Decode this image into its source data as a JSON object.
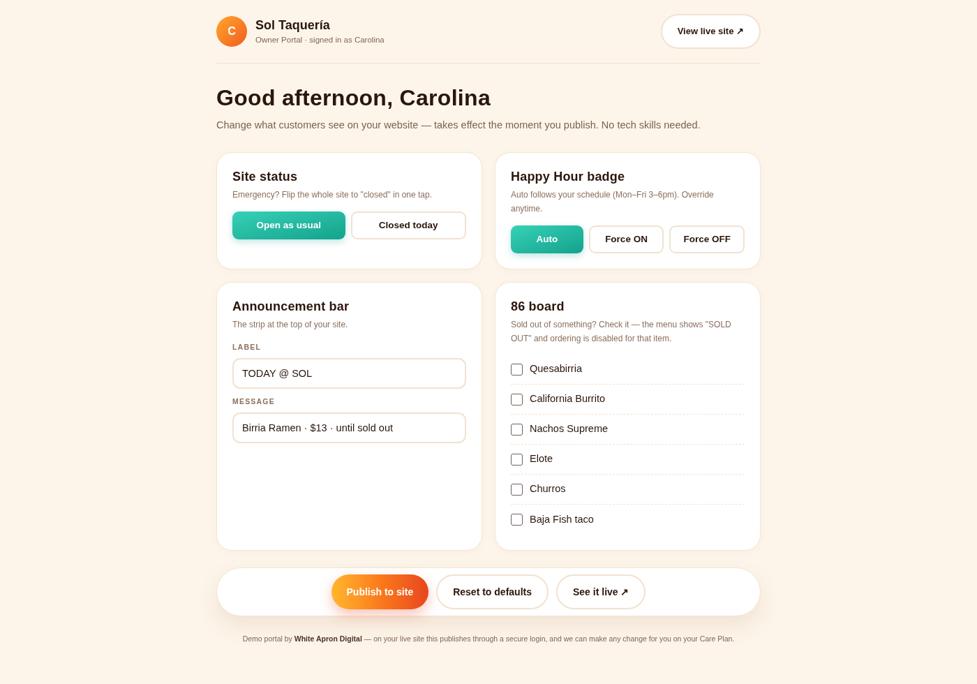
{
  "brand": {
    "logo_letter": "C",
    "name": "Sol Taquería",
    "subtitle": "Owner Portal · signed in as Carolina"
  },
  "header_button": "View live site ↗",
  "greeting": {
    "title": "Good afternoon, Carolina",
    "subtitle": "Change what customers see on your website — takes effect the moment you publish. No tech skills needed."
  },
  "site_status": {
    "title": "Site status",
    "description": "Emergency? Flip the whole site to \"closed\" in one tap.",
    "options": [
      {
        "label": "Open as usual",
        "selected": true
      },
      {
        "label": "Closed today",
        "selected": false
      }
    ]
  },
  "happy_hour": {
    "title": "Happy Hour badge",
    "description": "Auto follows your schedule (Mon–Fri 3–6pm). Override anytime.",
    "options": [
      {
        "label": "Auto",
        "selected": true
      },
      {
        "label": "Force ON",
        "selected": false
      },
      {
        "label": "Force OFF",
        "selected": false
      }
    ]
  },
  "announcement": {
    "title": "Announcement bar",
    "description": "The strip at the top of your site.",
    "fields": [
      {
        "label": "LABEL",
        "value": "TODAY @ SOL"
      },
      {
        "label": "MESSAGE",
        "value": "Birria Ramen · $13 · until sold out"
      }
    ]
  },
  "board": {
    "title": "86 board",
    "description": "Sold out of something? Check it — the menu shows \"SOLD OUT\" and ordering is disabled for that item.",
    "items": [
      {
        "label": "Quesabirria",
        "checked": false
      },
      {
        "label": "California Burrito",
        "checked": false
      },
      {
        "label": "Nachos Supreme",
        "checked": false
      },
      {
        "label": "Elote",
        "checked": false
      },
      {
        "label": "Churros",
        "checked": false
      },
      {
        "label": "Baja Fish taco",
        "checked": false
      }
    ]
  },
  "actions": [
    {
      "label": "Publish to site",
      "kind": "primary"
    },
    {
      "label": "Reset to defaults",
      "kind": "secondary"
    },
    {
      "label": "See it live ↗",
      "kind": "secondary"
    }
  ],
  "footer": "Demo portal by **White Apron Digital** — on your live site this publishes through a secure login, and we can make any change for you on your Care Plan."
}
